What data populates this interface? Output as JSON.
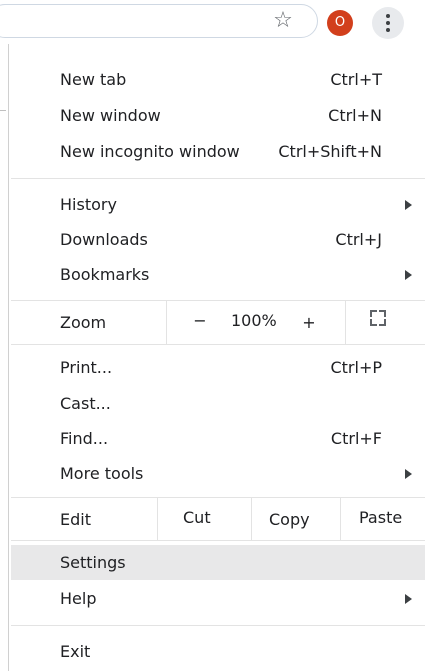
{
  "toolbar": {
    "star_icon": "star-outline-icon",
    "star_glyph": "☆",
    "avatar_letter": "O",
    "avatar_color": "#d23f1c",
    "menu_icon": "more-vertical-icon"
  },
  "menu": {
    "new_tab": {
      "label": "New tab",
      "shortcut": "Ctrl+T"
    },
    "new_window": {
      "label": "New window",
      "shortcut": "Ctrl+N"
    },
    "new_incognito": {
      "label": "New incognito window",
      "shortcut": "Ctrl+Shift+N"
    },
    "history": {
      "label": "History"
    },
    "downloads": {
      "label": "Downloads",
      "shortcut": "Ctrl+J"
    },
    "bookmarks": {
      "label": "Bookmarks"
    },
    "zoom": {
      "label": "Zoom",
      "minus": "−",
      "value": "100%",
      "plus": "+"
    },
    "print": {
      "label": "Print...",
      "shortcut": "Ctrl+P"
    },
    "cast": {
      "label": "Cast..."
    },
    "find": {
      "label": "Find...",
      "shortcut": "Ctrl+F"
    },
    "more_tools": {
      "label": "More tools"
    },
    "edit": {
      "label": "Edit",
      "cut": "Cut",
      "copy": "Copy",
      "paste": "Paste"
    },
    "settings": {
      "label": "Settings"
    },
    "help": {
      "label": "Help"
    },
    "exit": {
      "label": "Exit"
    }
  }
}
